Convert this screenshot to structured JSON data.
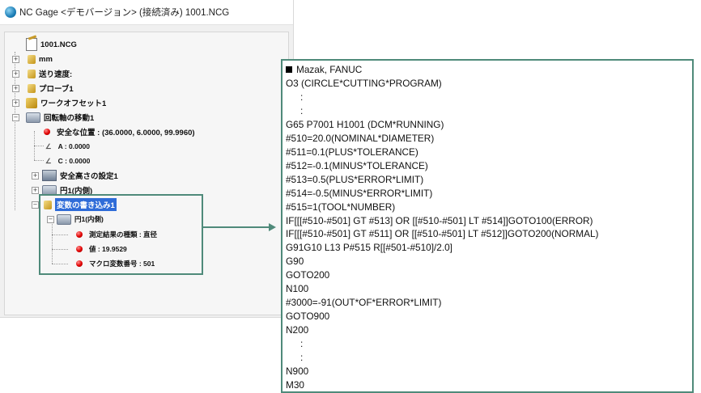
{
  "window": {
    "title": "NC Gage <デモバージョン> (接続済み) 1001.NCG"
  },
  "tree": {
    "root": "1001.NCG",
    "items": [
      {
        "label": "mm"
      },
      {
        "label": "送り速度:"
      },
      {
        "label": "プローブ1"
      },
      {
        "label": "ワークオフセット1"
      },
      {
        "label": "回転軸の移動1"
      },
      {
        "label": "安全な位置 : (36.0000, 6.0000, 99.9960)"
      },
      {
        "label": "A : 0.0000"
      },
      {
        "label": "C : 0.0000"
      },
      {
        "label": "安全高さの設定1"
      },
      {
        "label": "円1(内側)"
      },
      {
        "label": "変数の書き込み1"
      },
      {
        "label": "円1(内側)"
      },
      {
        "label": "測定結果の種類 : 直径"
      },
      {
        "label": "値 : 19.9529"
      },
      {
        "label": "マクロ変数番号 : 501"
      }
    ]
  },
  "code": {
    "header": "Mazak, FANUC",
    "lines": [
      "O3 (CIRCLE*CUTTING*PROGRAM)",
      ":",
      ":",
      "G65 P7001 H1001 (DCM*RUNNING)",
      "#510=20.0(NOMINAL*DIAMETER)",
      "#511=0.1(PLUS*TOLERANCE)",
      "#512=-0.1(MINUS*TOLERANCE)",
      "#513=0.5(PLUS*ERROR*LIMIT)",
      "#514=-0.5(MINUS*ERROR*LIMIT)",
      "#515=1(TOOL*NUMBER)",
      "IF[[[#510-#501] GT #513] OR [[#510-#501] LT #514]]GOTO100(ERROR)",
      "IF[[[#510-#501] GT #511] OR [[#510-#501] LT #512]]GOTO200(NORMAL)",
      "G91G10 L13 P#515 R[[#501-#510]/2.0]",
      "G90",
      "GOTO200",
      "N100",
      "#3000=-91(OUT*OF*ERROR*LIMIT)",
      "GOTO900",
      "N200",
      ":",
      ":",
      "N900",
      "M30"
    ]
  },
  "colors": {
    "accent_frame": "#4f8a7a",
    "selection": "#2f6cd8",
    "marker_red": "#e00000"
  }
}
